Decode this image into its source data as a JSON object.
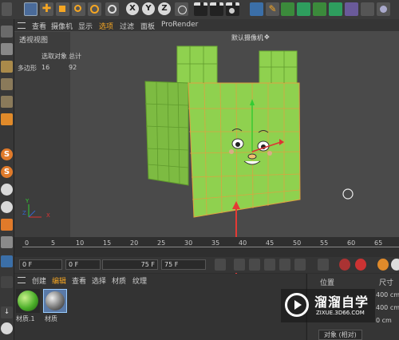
{
  "menu": {
    "items": [
      "查看",
      "摄像机",
      "显示",
      "选项",
      "过滤",
      "面板",
      "ProRender"
    ],
    "active_index": 3
  },
  "viewport": {
    "title": "透视视图",
    "camera_label": "默认摄像机",
    "stats": {
      "col1": "选取对象",
      "col2": "总计",
      "row_label": "多边形",
      "selected": "16",
      "total": "92"
    }
  },
  "toolbar": {
    "axes": [
      "X",
      "Y",
      "Z"
    ]
  },
  "timeline": {
    "ticks": [
      "0",
      "5",
      "10",
      "15",
      "20",
      "25",
      "30",
      "35",
      "40",
      "45",
      "50",
      "55",
      "60",
      "65"
    ]
  },
  "controls": {
    "current_frame": "0 F",
    "min_frame": "0 F",
    "max_frame": "75 F",
    "end_frame": "75 F"
  },
  "material_menu": {
    "items": [
      "创建",
      "编辑",
      "查看",
      "选择",
      "材质",
      "纹理"
    ],
    "active_index": 1
  },
  "materials": [
    {
      "name": "材质.1"
    },
    {
      "name": "材质"
    }
  ],
  "attributes": {
    "header": "位置",
    "header2": "尺寸",
    "size_x": "400 cm",
    "size_y": "400 cm",
    "size_z": "0 cm",
    "coord_mode": "对象 (相对)"
  },
  "watermark": {
    "title": "溜溜自学",
    "url": "ZIXUE.3D66.COM"
  },
  "colors": {
    "cube": "#8bc34a",
    "accent": "#f5a623",
    "annotation": "#e53935"
  }
}
